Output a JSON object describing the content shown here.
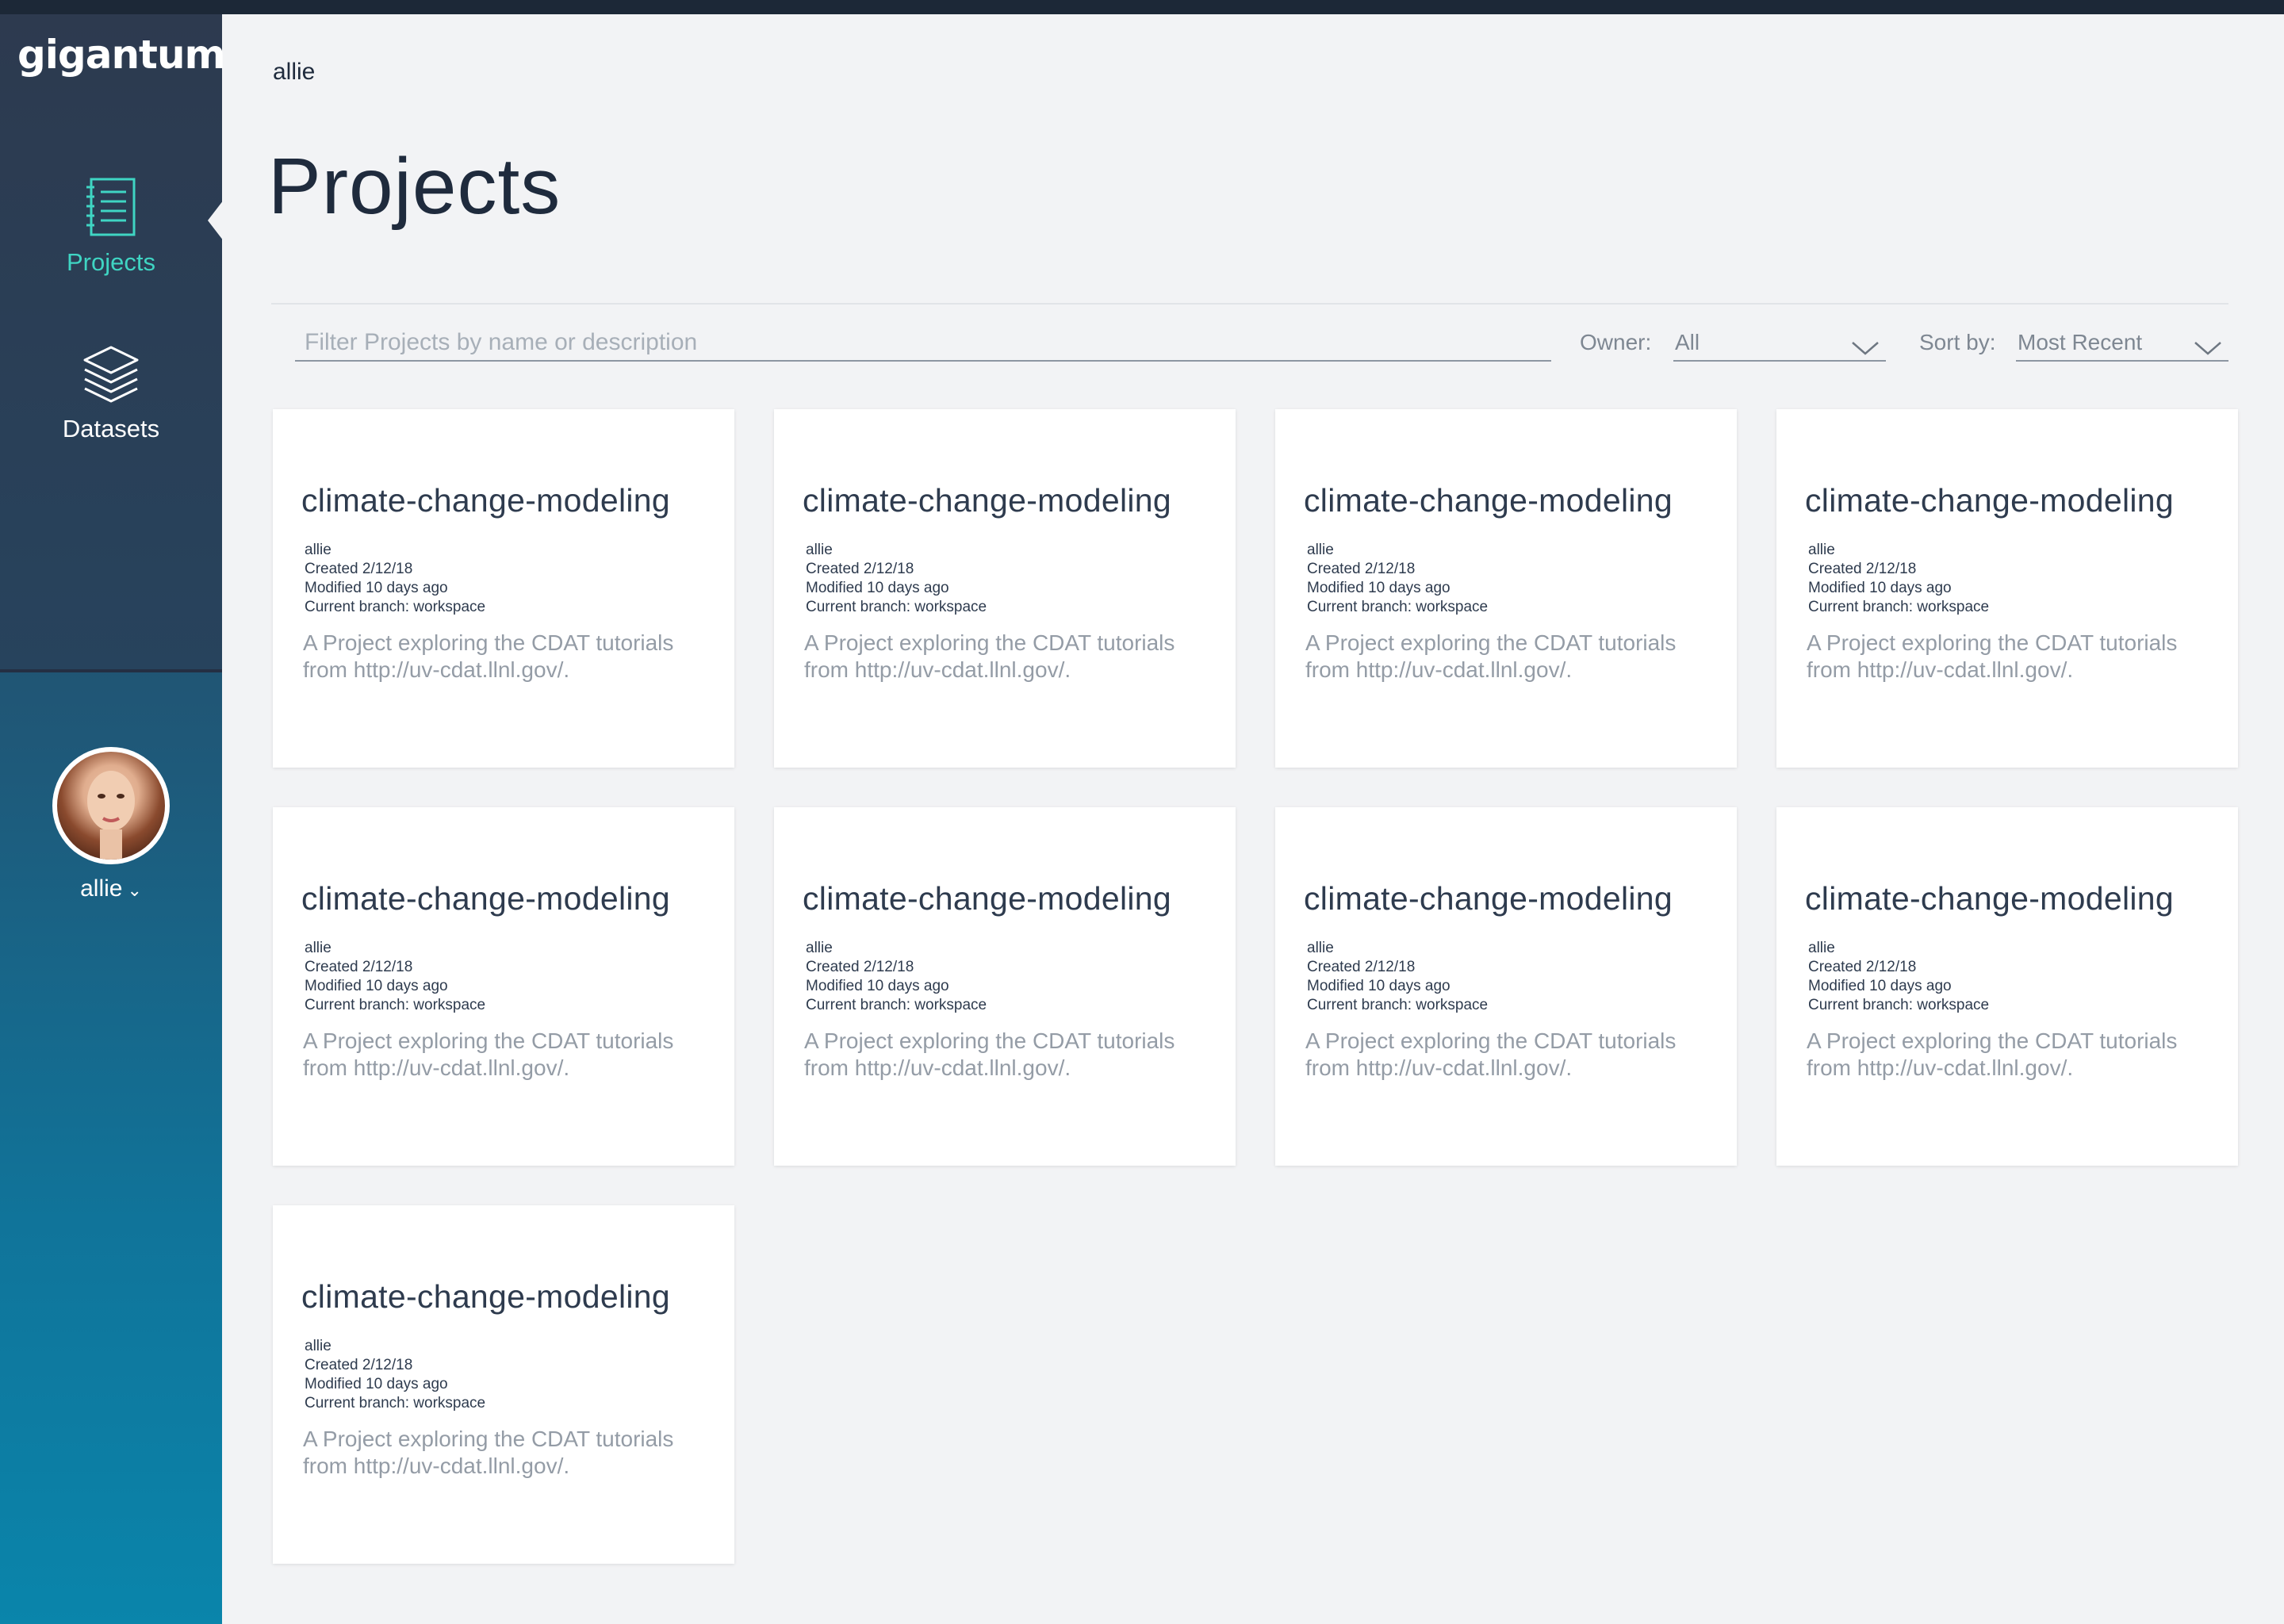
{
  "app": {
    "logo": "gigantum"
  },
  "sidebar": {
    "items": [
      {
        "label": "Projects",
        "icon": "notebook-icon",
        "active": true
      },
      {
        "label": "Datasets",
        "icon": "layers-icon",
        "active": false
      }
    ],
    "user": {
      "name": "allie",
      "avatar": "user-avatar-photo"
    }
  },
  "header": {
    "breadcrumb": "allie",
    "title": "Projects"
  },
  "toolbar": {
    "filter_placeholder": "Filter Projects by name or description",
    "owner_label": "Owner:",
    "owner_value": "All",
    "sort_label": "Sort by:",
    "sort_value": "Most Recent"
  },
  "projects": [
    {
      "title": "climate-change-modeling",
      "owner": "allie",
      "created": "Created 2/12/18",
      "modified": "Modified 10 days ago",
      "branch": "Current branch: workspace",
      "desc1": "A Project exploring the CDAT tutorials",
      "desc2": "from http://uv-cdat.llnl.gov/."
    },
    {
      "title": "climate-change-modeling",
      "owner": "allie",
      "created": "Created 2/12/18",
      "modified": "Modified 10 days ago",
      "branch": "Current branch: workspace",
      "desc1": "A Project exploring the CDAT tutorials",
      "desc2": "from http://uv-cdat.llnl.gov/."
    },
    {
      "title": "climate-change-modeling",
      "owner": "allie",
      "created": "Created 2/12/18",
      "modified": "Modified 10 days ago",
      "branch": "Current branch: workspace",
      "desc1": "A Project exploring the CDAT tutorials",
      "desc2": "from http://uv-cdat.llnl.gov/."
    },
    {
      "title": "climate-change-modeling",
      "owner": "allie",
      "created": "Created 2/12/18",
      "modified": "Modified 10 days ago",
      "branch": "Current branch: workspace",
      "desc1": "A Project exploring the CDAT tutorials",
      "desc2": "from http://uv-cdat.llnl.gov/."
    },
    {
      "title": "climate-change-modeling",
      "owner": "allie",
      "created": "Created 2/12/18",
      "modified": "Modified 10 days ago",
      "branch": "Current branch: workspace",
      "desc1": "A Project exploring the CDAT tutorials",
      "desc2": "from http://uv-cdat.llnl.gov/."
    },
    {
      "title": "climate-change-modeling",
      "owner": "allie",
      "created": "Created 2/12/18",
      "modified": "Modified 10 days ago",
      "branch": "Current branch: workspace",
      "desc1": "A Project exploring the CDAT tutorials",
      "desc2": "from http://uv-cdat.llnl.gov/."
    },
    {
      "title": "climate-change-modeling",
      "owner": "allie",
      "created": "Created 2/12/18",
      "modified": "Modified 10 days ago",
      "branch": "Current branch: workspace",
      "desc1": "A Project exploring the CDAT tutorials",
      "desc2": "from http://uv-cdat.llnl.gov/."
    },
    {
      "title": "climate-change-modeling",
      "owner": "allie",
      "created": "Created 2/12/18",
      "modified": "Modified 10 days ago",
      "branch": "Current branch: workspace",
      "desc1": "A Project exploring the CDAT tutorials",
      "desc2": "from http://uv-cdat.llnl.gov/."
    },
    {
      "title": "climate-change-modeling",
      "owner": "allie",
      "created": "Created 2/12/18",
      "modified": "Modified 10 days ago",
      "branch": "Current branch: workspace",
      "desc1": "A Project exploring the CDAT tutorials",
      "desc2": "from http://uv-cdat.llnl.gov/."
    }
  ],
  "colors": {
    "accent": "#3fd5c3",
    "sidebar_top": "#2d3a4f",
    "sidebar_bottom": "#0a85ab",
    "background": "#f2f3f5",
    "card": "#ffffff"
  }
}
